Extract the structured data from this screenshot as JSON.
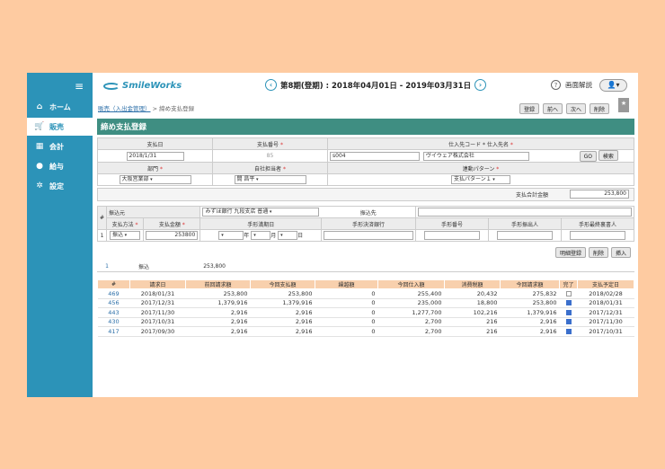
{
  "sidebar": {
    "menu_icon": "hamburger-icon",
    "items": [
      {
        "label": "ホーム",
        "icon": "home-icon"
      },
      {
        "label": "販売",
        "icon": "cart-icon"
      },
      {
        "label": "会計",
        "icon": "calculator-icon"
      },
      {
        "label": "給与",
        "icon": "money-bag-icon"
      },
      {
        "label": "設定",
        "icon": "gear-icon"
      }
    ]
  },
  "header": {
    "logo": "SmileWorks",
    "period": "第8期(登期) : 2018年04月01日 - 2019年03月31日",
    "help": "画面解説"
  },
  "breadcrumb": {
    "parent": "販売（入出金管理）",
    "sep": ">",
    "current": "締め支払登録"
  },
  "toolbar": {
    "register": "登録",
    "prev": "前へ",
    "next": "次へ",
    "delete": "削除"
  },
  "title": "締め支払登録",
  "form": {
    "h_date": "支払日",
    "date": "2018/1/31",
    "h_number": "支払番号",
    "number": "85",
    "h_vendor": "仕入先コード * 仕入先名",
    "vendor_code": "s004",
    "vendor_name": "ヴイウェア株式会社",
    "go": "GO",
    "search": "検索",
    "h_dept": "部門",
    "dept": "大阪営業部",
    "h_staff": "自社担当者",
    "staff": "間 昌平",
    "h_pattern": "連動パターン",
    "pattern": "支払パターン１"
  },
  "total": {
    "label": "支払合計金額",
    "value": "253,800"
  },
  "detail": {
    "h_no": "#",
    "no": "1",
    "h_bank": "振込元",
    "bank": "みずほ銀行 九段支店 普通",
    "h_dest": "振込先",
    "h_method": "支払方法",
    "method": "振込",
    "h_amount": "支払金額",
    "amount": "253800",
    "h_due": "手形満期日",
    "y": "年",
    "m": "月",
    "d": "日",
    "h_bill_bank": "手形決済銀行",
    "h_bill_no": "手形番号",
    "h_issuer": "手形振出人",
    "h_endorser": "手形最終裏書人"
  },
  "detail_buttons": {
    "add": "明細登録",
    "delete": "削除",
    "insert": "挿入"
  },
  "summary": {
    "no": "1",
    "method": "振込",
    "amount": "253,800"
  },
  "history": {
    "headers": [
      "#",
      "請求日",
      "前回請求額",
      "今回支払額",
      "繰越額",
      "今回仕入額",
      "消費税額",
      "今回請求額",
      "完了",
      "支払予定日"
    ],
    "rows": [
      {
        "id": "469",
        "date": "2018/01/31",
        "prev": "253,800",
        "pay": "253,800",
        "carry": "0",
        "purchase": "255,400",
        "tax": "20,432",
        "bill": "275,832",
        "done": false,
        "due": "2018/02/28"
      },
      {
        "id": "456",
        "date": "2017/12/31",
        "prev": "1,379,916",
        "pay": "1,379,916",
        "carry": "0",
        "purchase": "235,000",
        "tax": "18,800",
        "bill": "253,800",
        "done": true,
        "due": "2018/01/31"
      },
      {
        "id": "443",
        "date": "2017/11/30",
        "prev": "2,916",
        "pay": "2,916",
        "carry": "0",
        "purchase": "1,277,700",
        "tax": "102,216",
        "bill": "1,379,916",
        "done": true,
        "due": "2017/12/31"
      },
      {
        "id": "430",
        "date": "2017/10/31",
        "prev": "2,916",
        "pay": "2,916",
        "carry": "0",
        "purchase": "2,700",
        "tax": "216",
        "bill": "2,916",
        "done": true,
        "due": "2017/11/30"
      },
      {
        "id": "417",
        "date": "2017/09/30",
        "prev": "2,916",
        "pay": "2,916",
        "carry": "0",
        "purchase": "2,700",
        "tax": "216",
        "bill": "2,916",
        "done": true,
        "due": "2017/10/31"
      }
    ]
  }
}
